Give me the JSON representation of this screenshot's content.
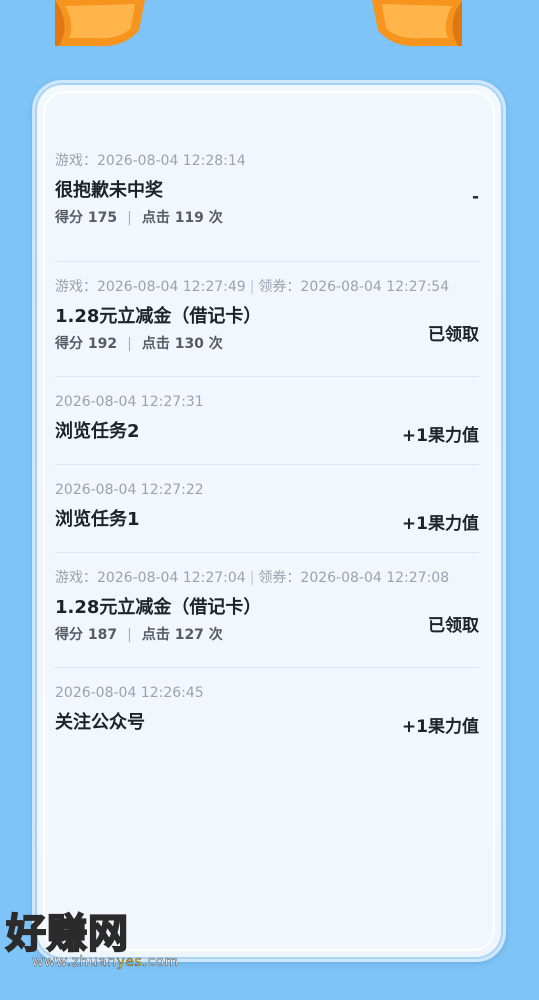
{
  "records": [
    {
      "meta_game": "游戏：2026-08-04 12:28:14",
      "meta_coupon": "",
      "title": "很抱歉未中奖",
      "score_label": "得分 175",
      "click_label": "点击 119 次",
      "status": "-"
    },
    {
      "meta_game": "游戏：2026-08-04 12:27:49",
      "meta_coupon": "领券：2026-08-04 12:27:54",
      "title": "1.28元立减金（借记卡）",
      "score_label": "得分 192",
      "click_label": "点击 130 次",
      "status": "已领取"
    },
    {
      "meta_game": "2026-08-04 12:27:31",
      "title": "浏览任务2",
      "status": "+1果力值"
    },
    {
      "meta_game": "2026-08-04 12:27:22",
      "title": "浏览任务1",
      "status": "+1果力值"
    },
    {
      "meta_game": "游戏：2026-08-04 12:27:04",
      "meta_coupon": "领券：2026-08-04 12:27:08",
      "title": "1.28元立减金（借记卡）",
      "score_label": "得分 187",
      "click_label": "点击 127 次",
      "status": "已领取"
    },
    {
      "meta_game": "2026-08-04 12:26:45",
      "title": "关注公众号",
      "status": "+1果力值"
    }
  ],
  "watermark": {
    "text": "好赚网",
    "url_prefix": "www.zhuan",
    "url_highlight": "yes",
    "url_suffix": ".com"
  },
  "colors": {
    "background": "#7ec4f6",
    "ribbon": "#f7941d",
    "card": "#f2f7fd"
  }
}
